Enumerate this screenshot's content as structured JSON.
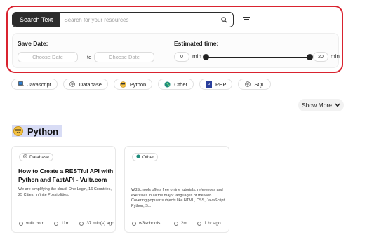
{
  "search": {
    "button_label": "Search Text",
    "placeholder": "Search for your resources"
  },
  "filters": {
    "save_date_label": "Save Date:",
    "date_from_placeholder": "Choose Date",
    "to_label": "to",
    "date_to_placeholder": "Choose Date",
    "estimated_time_label": "Estimated time:",
    "min_value": "0",
    "max_value": "20",
    "unit": "min"
  },
  "tags": [
    {
      "label": "Javascript",
      "icon": "laptop-icon"
    },
    {
      "label": "Database",
      "icon": "plus-circle-icon"
    },
    {
      "label": "Python",
      "icon": "python-emoji-icon"
    },
    {
      "label": "Other",
      "icon": "globe-icon"
    },
    {
      "label": "PHP",
      "icon": "php-icon"
    },
    {
      "label": "SQL",
      "icon": "plus-circle-icon"
    }
  ],
  "show_more_label": "Show More",
  "section": {
    "title": "Python"
  },
  "cards": [
    {
      "badge": "Database",
      "title": "How to Create a RESTful API with Python and FastAPI - Vultr.com",
      "description": "We are simplifying the cloud. One Login, 16 Countries, 25 Cities, Infinite Possibilities.",
      "source": "vultr.com",
      "duration": "11m",
      "time_ago": "37 min(s) ago"
    },
    {
      "badge": "Other",
      "title": "",
      "description": "W3Schools offers free online tutorials, references and exercises in all the major languages of the web. Covering popular subjects like HTML, CSS, JavaScript, Python, S...",
      "source": "w3schools...",
      "duration": "2m",
      "time_ago": "1 hr ago"
    }
  ],
  "colors": {
    "highlight_border": "#d9232f",
    "section_highlight": "#d8dcf5",
    "search_button": "#2c2c2c"
  }
}
